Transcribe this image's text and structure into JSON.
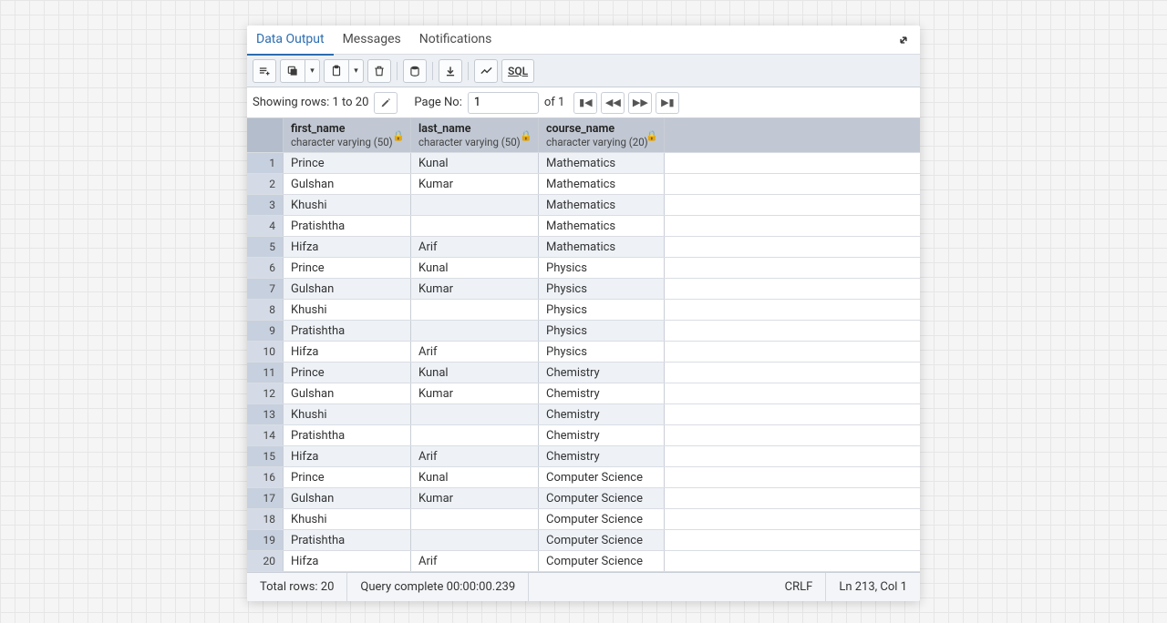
{
  "tabs": {
    "data_output": "Data Output",
    "messages": "Messages",
    "notifications": "Notifications"
  },
  "toolbar": {
    "sql_label": "SQL"
  },
  "rows_bar": {
    "showing_text": "Showing rows: 1 to 20",
    "page_no_label": "Page No:",
    "page_no_value": "1",
    "of_label": "of 1"
  },
  "columns": [
    {
      "name": "first_name",
      "type": "character varying (50)"
    },
    {
      "name": "last_name",
      "type": "character varying (50)"
    },
    {
      "name": "course_name",
      "type": "character varying (20)"
    }
  ],
  "rows": [
    {
      "n": "1",
      "c0": "Prince",
      "c1": "Kunal",
      "c2": "Mathematics"
    },
    {
      "n": "2",
      "c0": "Gulshan",
      "c1": "Kumar",
      "c2": "Mathematics"
    },
    {
      "n": "3",
      "c0": "Khushi",
      "c1": "",
      "c2": "Mathematics"
    },
    {
      "n": "4",
      "c0": "Pratishtha",
      "c1": "",
      "c2": "Mathematics"
    },
    {
      "n": "5",
      "c0": "Hifza",
      "c1": "Arif",
      "c2": "Mathematics"
    },
    {
      "n": "6",
      "c0": "Prince",
      "c1": "Kunal",
      "c2": "Physics"
    },
    {
      "n": "7",
      "c0": "Gulshan",
      "c1": "Kumar",
      "c2": "Physics"
    },
    {
      "n": "8",
      "c0": "Khushi",
      "c1": "",
      "c2": "Physics"
    },
    {
      "n": "9",
      "c0": "Pratishtha",
      "c1": "",
      "c2": "Physics"
    },
    {
      "n": "10",
      "c0": "Hifza",
      "c1": "Arif",
      "c2": "Physics"
    },
    {
      "n": "11",
      "c0": "Prince",
      "c1": "Kunal",
      "c2": "Chemistry"
    },
    {
      "n": "12",
      "c0": "Gulshan",
      "c1": "Kumar",
      "c2": "Chemistry"
    },
    {
      "n": "13",
      "c0": "Khushi",
      "c1": "",
      "c2": "Chemistry"
    },
    {
      "n": "14",
      "c0": "Pratishtha",
      "c1": "",
      "c2": "Chemistry"
    },
    {
      "n": "15",
      "c0": "Hifza",
      "c1": "Arif",
      "c2": "Chemistry"
    },
    {
      "n": "16",
      "c0": "Prince",
      "c1": "Kunal",
      "c2": "Computer Science"
    },
    {
      "n": "17",
      "c0": "Gulshan",
      "c1": "Kumar",
      "c2": "Computer Science"
    },
    {
      "n": "18",
      "c0": "Khushi",
      "c1": "",
      "c2": "Computer Science"
    },
    {
      "n": "19",
      "c0": "Pratishtha",
      "c1": "",
      "c2": "Computer Science"
    },
    {
      "n": "20",
      "c0": "Hifza",
      "c1": "Arif",
      "c2": "Computer Science"
    }
  ],
  "status": {
    "total_rows": "Total rows: 20",
    "query_complete": "Query complete 00:00:00.239",
    "line_ending": "CRLF",
    "cursor": "Ln 213, Col 1"
  }
}
